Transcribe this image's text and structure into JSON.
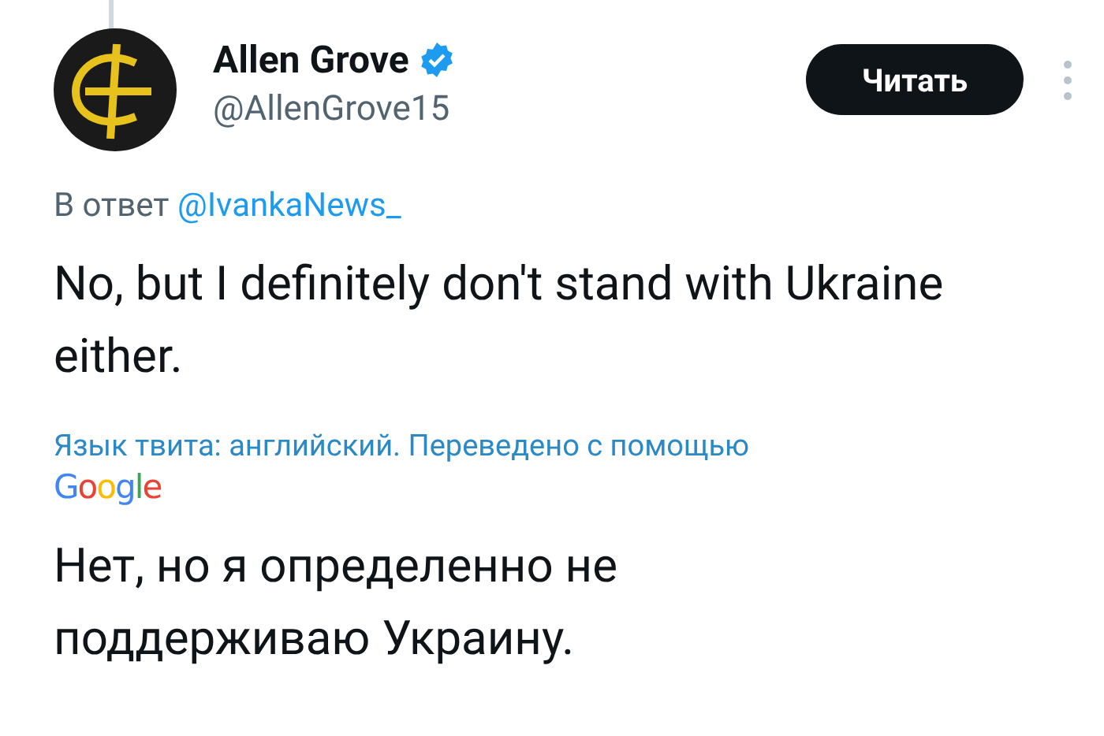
{
  "author": {
    "name": "Allen Grove",
    "verified": true,
    "handle": "@AllenGrove15"
  },
  "follow_button": {
    "label": "Читать"
  },
  "reply_to": {
    "prefix": "В ответ",
    "mention": "@IvankaNews_"
  },
  "tweet_text": "No, but  I definitely don't stand with Ukraine either.",
  "translation": {
    "note": "Язык твита: английский. Переведено с помощью",
    "provider": "Google",
    "text": "Нет, но я определенно не поддерживаю Украину."
  }
}
